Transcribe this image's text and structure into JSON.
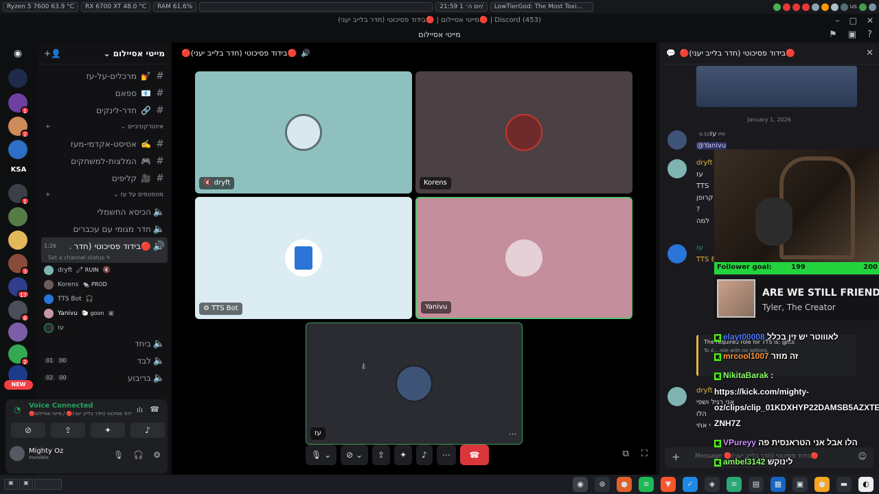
{
  "sysbar": {
    "cpu": "Ryzen 5 7600  63.9 °C",
    "gpu": "RX 6700 XT  48.0 °C",
    "ram": "RAM    61.6%",
    "clock": "21:59 יום ה׳ 1/",
    "media": "LowTierGod: The Most Toxi...",
    "lang": "us"
  },
  "window": {
    "title": "מייטי אסיילום | 🔴בידוד פסיכוטי (חדר בלייב יעני)🔴 | Discord (453)",
    "header_caption": "מייטי אסיילום",
    "colors": {
      "accent": "#5865f2",
      "green": "#23a55a",
      "danger": "#da373c"
    }
  },
  "rail": {
    "ksa": "KSA",
    "new": "NEW",
    "badges": [
      "1",
      "2",
      "1",
      "3",
      "17",
      "8",
      "2"
    ]
  },
  "sidebar": {
    "guild_name": "מייטי אסיילום",
    "channels_top": [
      {
        "label": "מרכלים-על-עז",
        "emoji": "💅"
      },
      {
        "label": "ספאם",
        "emoji": "📧"
      },
      {
        "label": "חדר-לינקים",
        "emoji": "🔗"
      }
    ],
    "cat_interactive": "אינטרקטיביים",
    "channels_interactive": [
      {
        "label": "אסיסט-אקדמי-מעז",
        "emoji": "✍️"
      },
      {
        "label": "המלצות-למשחקים",
        "emoji": "🎮"
      },
      {
        "label": "קליפים",
        "emoji": "🎥"
      }
    ],
    "cat_voice": "מטפטפים על עז",
    "voice_channels": [
      {
        "label": "הכיסא החשמלי"
      },
      {
        "label": "חדר מגומי עם עכברים"
      }
    ],
    "active_voice": {
      "label": "🔴בידוד פסיכוטי (חדר בלייב יעני)🔴",
      "time": "1:26",
      "status": "Set a channel status"
    },
    "voice_users": [
      {
        "name": "dryft",
        "tag": "🧷 RUIN",
        "color": "#7fb3b1"
      },
      {
        "name": "Korens",
        "tag": "🐀 PROD",
        "color": "#6b5b5d"
      },
      {
        "name": "TTS Bot",
        "tag": "",
        "color": "#2b74d8"
      },
      {
        "name": "Yanivu",
        "tag": "🐑 goon",
        "color": "#c996a4"
      },
      {
        "name": "עז",
        "tag": "",
        "color": "#2c2e33"
      }
    ],
    "voice_channels_after": [
      {
        "label": "ביחד",
        "counts": []
      },
      {
        "label": "לבד",
        "counts": [
          "00",
          "01"
        ]
      },
      {
        "label": "בריבוע",
        "counts": [
          "00",
          "02"
        ]
      }
    ]
  },
  "voice_panel": {
    "title": "Voice Connected",
    "subtitle": "🔴בידוד פסיכוטי (חדר בלייב יעני)🔴 / מייטי אסיילום",
    "user": "Mighty Oz",
    "status": "Invisible"
  },
  "call": {
    "header": "🔴בידוד פסיכוטי (חדר בלייב יעני)🔴",
    "tiles": [
      {
        "name": "dryft",
        "bg": "#8ec1be",
        "avatar": "#d9e7ee"
      },
      {
        "name": "Korens",
        "bg": "#4b4043",
        "avatar": "#6f2b2b"
      },
      {
        "name": "TTS Bot",
        "bg": "#dcecf3",
        "avatar": "#2b74d8"
      },
      {
        "name": "Yanivu",
        "bg": "#c48e9c",
        "avatar": "#e5d0d8"
      },
      {
        "name": "עז",
        "bg": "#2a2c32",
        "avatar": "#3e5477"
      }
    ]
  },
  "chat": {
    "header": "🔴בידוד פסיכוטי (חדר בלייב יעני)🔴",
    "date": "January 1, 2026",
    "msg1": {
      "name": "עז",
      "time": "9:50 PM",
      "mention": "@Yanivu"
    },
    "msg2": {
      "name": "dryft",
      "lines": "עז\nTTS\nקרופן\n?\nלמה"
    },
    "msg3": {
      "name": "עז",
      "bot": "TTS Bot"
    },
    "tts_embed": {
      "title": "The required role for TTS is: @tts",
      "sub": "To d... role with no options."
    },
    "msg4": {
      "name": "dryft",
      "lines": "אני רגיל ושפי\nהלו\nי אחי"
    },
    "input_placeholder": "Message 🔴בידוד פסיכוטי (חדר בלייב יעני)🔴"
  },
  "overlay": {
    "goal_label": "Follower goal:",
    "goal_current": "199",
    "goal_target": "200",
    "song": "ARE WE STILL FRIENDS?",
    "artist": "Tyler, The Creator",
    "kick_chat": [
      {
        "user": "elayt00008",
        "text": "לאוווטר יש זין בכלל",
        "color": "#4d7bff"
      },
      {
        "user": "mrcool1007",
        "text": "זה מוזר",
        "color": "#ff9b3d"
      },
      {
        "user": "NikitaBarak",
        "text": ":",
        "color": "#8dff6b"
      },
      {
        "user": "",
        "text": "https://kick.com/mighty-",
        "color": "#ffffff"
      },
      {
        "user": "",
        "text": "oz/clips/clip_01KDXHYP22DAMSB5AZXTE",
        "color": "#ffffff"
      },
      {
        "user": "",
        "text": "ZNH7Z",
        "color": "#ffffff"
      },
      {
        "user": "VPureyy",
        "text": "הלו אבל אני הטראנסית פה",
        "color": "#d08cff"
      },
      {
        "user": "ambel3142",
        "text": "לינוקש",
        "color": "#8dff6b"
      }
    ]
  }
}
